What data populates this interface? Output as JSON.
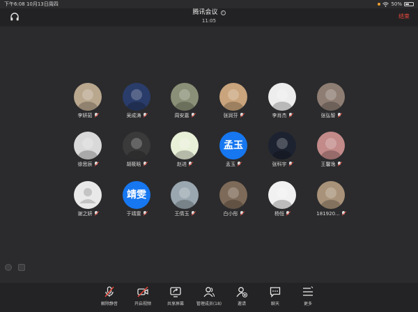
{
  "status": {
    "time_date": "下午6:08  10月13日周四",
    "battery_pct": "50%",
    "battery_level": 0.5
  },
  "header": {
    "title": "腾讯会议",
    "info": "i",
    "timer": "11:05",
    "end_label": "结束"
  },
  "participants": [
    {
      "name": "李妍茹",
      "avatar": "photo",
      "color": "#b9a78e"
    },
    {
      "name": "吴成涛",
      "avatar": "photo",
      "color": "#2a3c6a"
    },
    {
      "name": "周安嘉",
      "avatar": "photo",
      "color": "#8a9077"
    },
    {
      "name": "张润芬",
      "avatar": "photo",
      "color": "#c9a47c"
    },
    {
      "name": "李肖杰",
      "avatar": "photo",
      "color": "#ededed"
    },
    {
      "name": "张弘智",
      "avatar": "photo",
      "color": "#8e7d73"
    },
    {
      "name": "徐思辰",
      "avatar": "photo",
      "color": "#d9d9d9"
    },
    {
      "name": "胡筱晗",
      "avatar": "photo",
      "color": "#3a3a3a"
    },
    {
      "name": "赵进",
      "avatar": "photo",
      "color": "#e8f0d8"
    },
    {
      "name": "孟玉",
      "avatar": "text",
      "text": "孟玉",
      "color": "#1677f0"
    },
    {
      "name": "张科宇",
      "avatar": "photo",
      "color": "#1c2230"
    },
    {
      "name": "王馨逸",
      "avatar": "photo",
      "color": "#c38a8a"
    },
    {
      "name": "谢之妍",
      "avatar": "default",
      "color": "#e9e9e9"
    },
    {
      "name": "于靖雯",
      "avatar": "text",
      "text": "靖雯",
      "color": "#1677f0"
    },
    {
      "name": "王倩玉",
      "avatar": "photo",
      "color": "#9aa7b0"
    },
    {
      "name": "白小彤",
      "avatar": "photo",
      "color": "#7d6a58"
    },
    {
      "name": "杨恒",
      "avatar": "photo",
      "color": "#f1f1f1"
    },
    {
      "name": "181920...",
      "avatar": "photo",
      "color": "#a89279"
    }
  ],
  "toolbar": [
    {
      "label": "解除静音",
      "icon": "mic-off-icon"
    },
    {
      "label": "开启视频",
      "icon": "video-off-icon"
    },
    {
      "label": "共享屏幕",
      "icon": "share-screen-icon"
    },
    {
      "label": "管理成员(18)",
      "icon": "members-icon"
    },
    {
      "label": "邀请",
      "icon": "invite-icon"
    },
    {
      "label": "聊天",
      "icon": "chat-icon"
    },
    {
      "label": "更多",
      "icon": "more-icon"
    }
  ]
}
